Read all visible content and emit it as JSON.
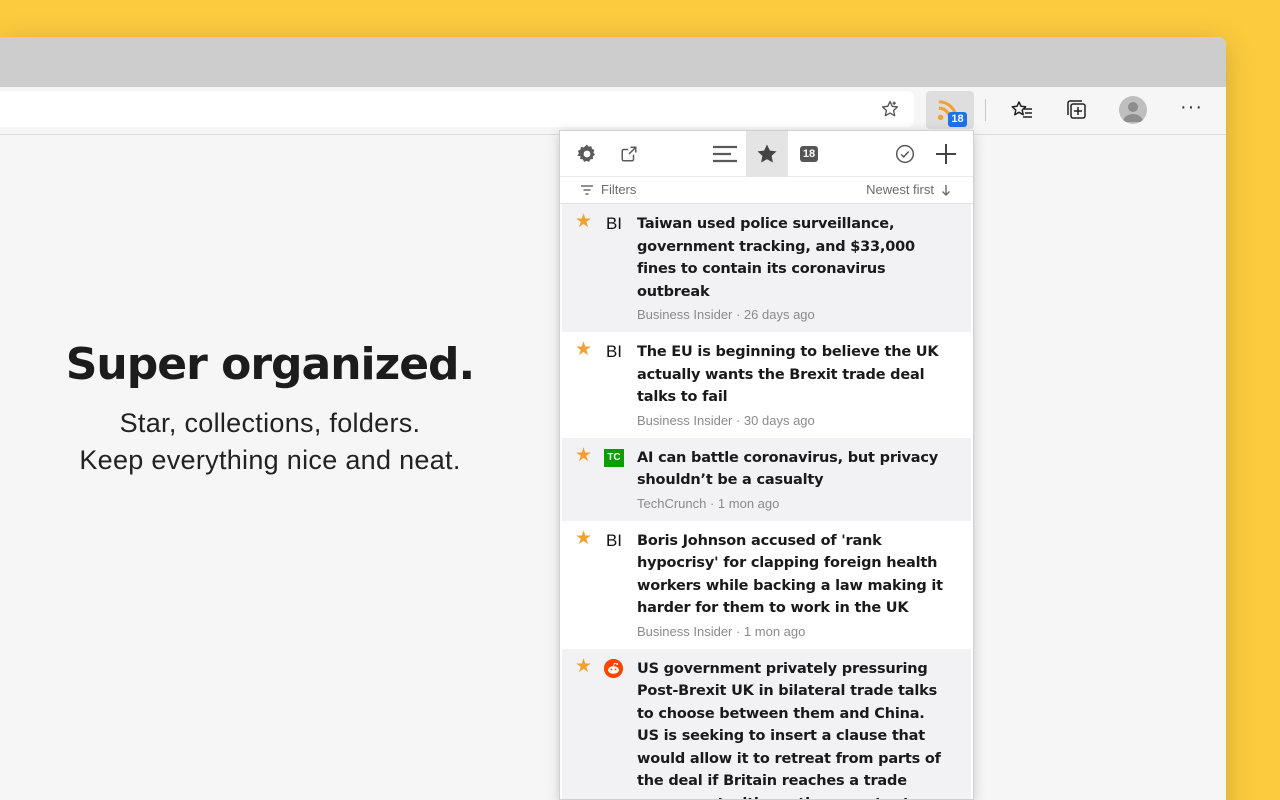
{
  "browser": {
    "extension_badge": "18"
  },
  "promo": {
    "heading": "Super organized.",
    "line1": "Star, collections, folders.",
    "line2": "Keep everything nice and neat."
  },
  "popup": {
    "toolbar": {
      "unread_count": "18",
      "icons": [
        "gear-icon",
        "open-external-icon",
        "list-icon",
        "star-icon",
        "count-badge",
        "check-circle-icon",
        "plus-icon"
      ]
    },
    "filter_label": "Filters",
    "sort_label": "Newest first",
    "articles": [
      {
        "title": "Taiwan used police surveillance, government tracking, and $33,000 fines to contain its coronavirus outbreak",
        "source_logo": "BI",
        "meta": "Business Insider · 26 days ago"
      },
      {
        "title": "The EU is beginning to believe the UK actually wants the Brexit trade deal talks to fail",
        "source_logo": "BI",
        "meta": "Business Insider · 30 days ago"
      },
      {
        "title": "AI can battle coronavirus, but privacy shouldn’t be a casualty",
        "source_logo": "TC",
        "meta": "TechCrunch · 1 mon ago"
      },
      {
        "title": "Boris Johnson accused of 'rank hypocrisy' for clapping foreign health workers while backing a law making it harder for them to work in the UK",
        "source_logo": "BI",
        "meta": "Business Insider · 1 mon ago"
      },
      {
        "title": "US government privately pressuring Post-Brexit UK in bilateral trade talks to choose between them and China. US is seeking to insert a clause that would allow it to retreat from parts of the deal if Britain reaches a trade agreement with another country t",
        "source_logo": "reddit-icon",
        "meta": ""
      }
    ]
  },
  "colors": {
    "background": "#fccb3e",
    "star": "#f0a132",
    "badge": "#1a73e8"
  }
}
